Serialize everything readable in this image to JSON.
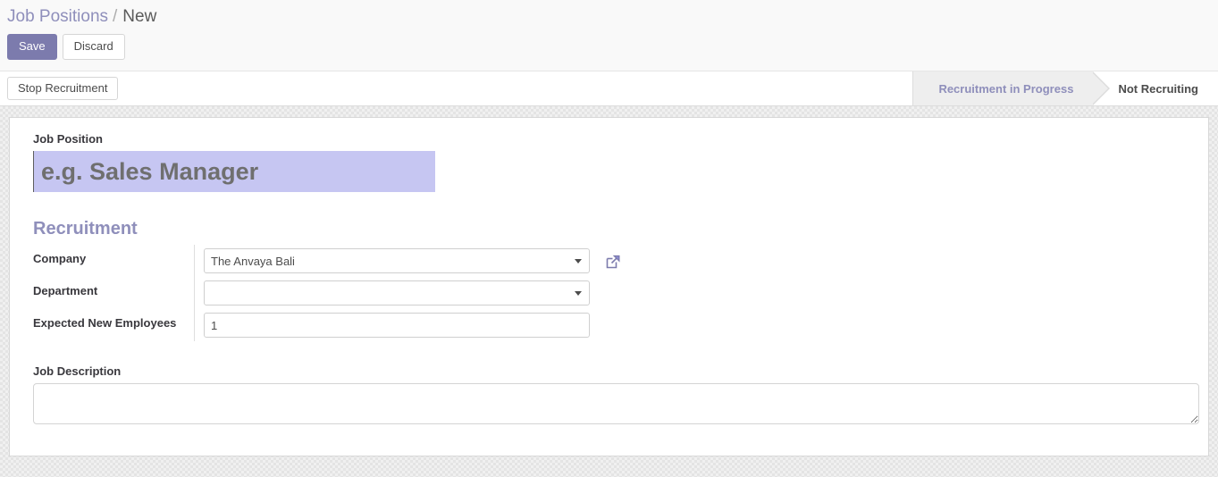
{
  "breadcrumb": {
    "parent": "Job Positions",
    "separator": "/",
    "current": "New"
  },
  "actions": {
    "save_label": "Save",
    "discard_label": "Discard"
  },
  "statusbar": {
    "stop_recruitment_label": "Stop Recruitment",
    "stages": [
      {
        "label": "Recruitment in Progress",
        "state": "done"
      },
      {
        "label": "Not Recruiting",
        "state": "current"
      }
    ]
  },
  "form": {
    "job_position": {
      "label": "Job Position",
      "value": "",
      "placeholder": "e.g. Sales Manager"
    },
    "section_recruitment": "Recruitment",
    "company": {
      "label": "Company",
      "value": "The Anvaya Bali",
      "icon": "external-link-icon"
    },
    "department": {
      "label": "Department",
      "value": ""
    },
    "expected_new_employees": {
      "label": "Expected New Employees",
      "value": "1"
    },
    "job_description": {
      "label": "Job Description",
      "value": ""
    }
  },
  "colors": {
    "brand_purple": "#7c7bad",
    "link_purple": "#8f8fbb",
    "focus_field": "#c6c6f2"
  }
}
